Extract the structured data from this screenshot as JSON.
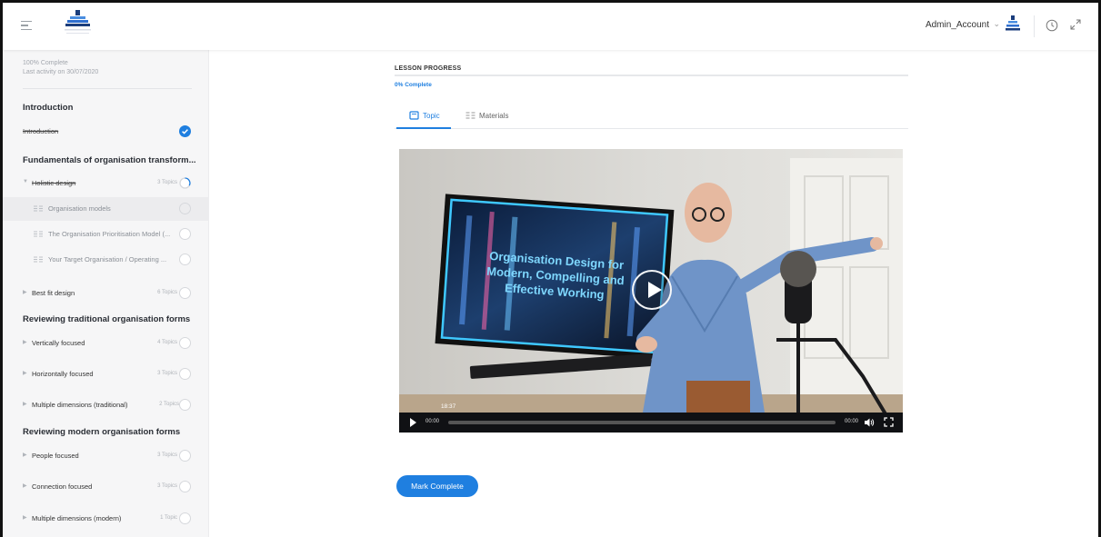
{
  "header": {
    "account_name": "Admin_Account"
  },
  "sidebar": {
    "progress_complete": "100% Complete",
    "last_activity": "Last activity on 30/07/2020",
    "sections": [
      {
        "title": "Introduction"
      },
      {
        "title": "Fundamentals of organisation transform..."
      },
      {
        "title": "Reviewing traditional organisation forms"
      },
      {
        "title": "Reviewing modern organisation forms"
      }
    ],
    "items": [
      {
        "label": "Introduction",
        "count": ""
      },
      {
        "label": "Holistic design",
        "count": "3 Topics"
      },
      {
        "label": "Organisation models",
        "count": ""
      },
      {
        "label": "The Organisation Prioritisation Model (...",
        "count": ""
      },
      {
        "label": "Your Target Organisation / Operating ...",
        "count": ""
      },
      {
        "label": "Best fit design",
        "count": "6 Topics"
      },
      {
        "label": "Vertically focused",
        "count": "4 Topics"
      },
      {
        "label": "Horizontally focused",
        "count": "3 Topics"
      },
      {
        "label": "Multiple dimensions (traditional)",
        "count": "2 Topics"
      },
      {
        "label": "People focused",
        "count": "3 Topics"
      },
      {
        "label": "Connection focused",
        "count": "3 Topics"
      },
      {
        "label": "Multiple dimensions (modern)",
        "count": "1 Topic"
      }
    ]
  },
  "main": {
    "lesson_progress_label": "LESSON PROGRESS",
    "lesson_progress_pct": "0% Complete",
    "lesson_progress_value": 0,
    "tabs": [
      {
        "label": "Topic"
      },
      {
        "label": "Materials"
      }
    ],
    "video": {
      "screen_title_line1": "Organisation Design for",
      "screen_title_line2": "Modern, Compelling and",
      "screen_title_line3": "Effective Working",
      "hover_time": "18:37",
      "current_time": "00:00",
      "duration": "00:00"
    },
    "mark_complete_label": "Mark Complete"
  },
  "colors": {
    "accent": "#1f7fe0",
    "sidebar_bg": "#f6f6f7"
  }
}
